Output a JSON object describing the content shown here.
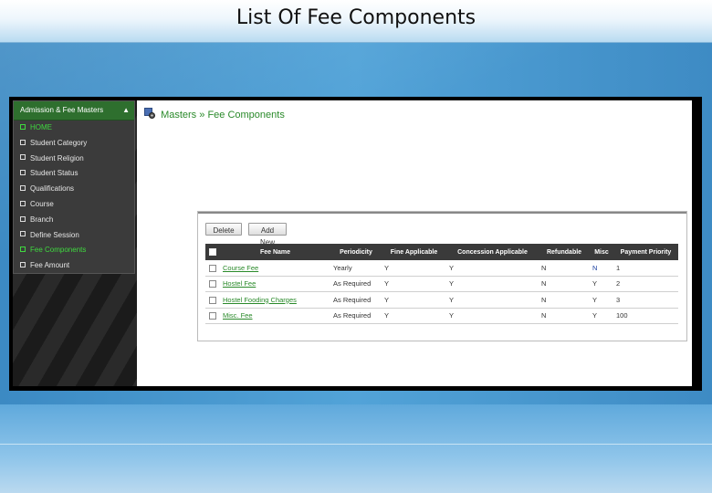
{
  "slide": {
    "title": "List Of Fee Components"
  },
  "sidebar": {
    "header": "Admission & Fee Masters",
    "items": [
      {
        "label": "HOME",
        "active": true
      },
      {
        "label": "Student Category",
        "active": false
      },
      {
        "label": "Student Religion",
        "active": false
      },
      {
        "label": "Student Status",
        "active": false
      },
      {
        "label": "Qualifications",
        "active": false
      },
      {
        "label": "Course",
        "active": false
      },
      {
        "label": "Branch",
        "active": false
      },
      {
        "label": "Define Session",
        "active": false
      },
      {
        "label": "Fee Components",
        "active": true
      },
      {
        "label": "Fee Amount",
        "active": false
      }
    ]
  },
  "breadcrumb": {
    "root": "Masters",
    "separator": "»",
    "current": "Fee Components"
  },
  "toolbar": {
    "delete_label": "Delete",
    "add_label": "Add New"
  },
  "table": {
    "columns": [
      "Fee Name",
      "Periodicity",
      "Fine Applicable",
      "Concession Applicable",
      "Refundable",
      "Misc",
      "Payment Priority"
    ],
    "rows": [
      {
        "fee_name": "Course Fee",
        "periodicity": "Yearly",
        "fine": "Y",
        "concession": "Y",
        "refundable": "N",
        "misc": "N",
        "priority": "1"
      },
      {
        "fee_name": "Hostel Fee",
        "periodicity": "As Required",
        "fine": "Y",
        "concession": "Y",
        "refundable": "N",
        "misc": "Y",
        "priority": "2"
      },
      {
        "fee_name": "Hostel Fooding Charges",
        "periodicity": "As Required",
        "fine": "Y",
        "concession": "Y",
        "refundable": "N",
        "misc": "Y",
        "priority": "3"
      },
      {
        "fee_name": "Misc. Fee",
        "periodicity": "As Required",
        "fine": "Y",
        "concession": "Y",
        "refundable": "N",
        "misc": "Y",
        "priority": "100"
      }
    ]
  },
  "colors": {
    "accent_green": "#2a8a2a",
    "menu_header_green": "#2e6f2e",
    "active_menu_green": "#3fd93f",
    "table_header": "#3a3a3a",
    "slide_blue": "#3c8ac3"
  },
  "icons": {
    "breadcrumb": "gear-icon",
    "menu_collapse": "chevron-up-icon"
  }
}
